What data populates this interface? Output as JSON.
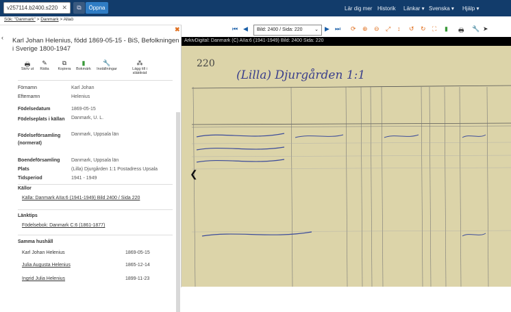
{
  "search": {
    "value": "v257114.b2400.s220"
  },
  "top": {
    "open_label": "Öppna",
    "nav": [
      "Lär dig mer",
      "Historik",
      "Länkar ▾",
      "Svenska ▾",
      "Hjälp ▾"
    ]
  },
  "breadcrumb": {
    "items": [
      "Sök: \"Danmark\"",
      "Danmark",
      "Allaö"
    ]
  },
  "panel": {
    "title": "Karl Johan Helenius, född 1869-05-15 - BiS, Befolkningen i Sverige 1800-1947",
    "tools": [
      "Skriv ut",
      "Rätta",
      "Kopiera",
      "Bokmärk",
      "Inställningar",
      "Lägg till i släktträd"
    ],
    "fields": [
      {
        "label": "Förnamn",
        "value": "Karl Johan"
      },
      {
        "label": "Efternamn",
        "value": "Helenius"
      },
      {
        "label": "Födelsedatum",
        "value": "1869-05-15"
      },
      {
        "label": "Födelseplats i källan",
        "value": "Danmark, U. L."
      },
      {
        "label": "Födelseförsamling (normerat)",
        "value": "Danmark, Uppsala län"
      },
      {
        "label": "Boendeförsamling",
        "value": "Danmark, Uppsala län"
      },
      {
        "label": "Plats",
        "value": "(Lilla) Djurgården 1:1 Postadress Upsala"
      },
      {
        "label": "Tidsperiod",
        "value": "1941 - 1949"
      }
    ],
    "sources_title": "Källor",
    "source_link": "Källa: Danmark AIIa:6 (1941-1949) Bild 2400 / Sida 220",
    "links_title": "Länktips",
    "links_link": "Födelsebok: Danmark C:6 (1861-1877)",
    "household_title": "Samma hushåll",
    "household": [
      {
        "name": "Karl Johan Helenius",
        "date": "1869-05-15"
      },
      {
        "name": "Julia Augusta Helenius",
        "date": "1865-12-14"
      },
      {
        "name": "Ingrid Julia Helenius",
        "date": "1899-11-23"
      }
    ]
  },
  "viewer": {
    "select": "Bild: 2400 / Sida: 220",
    "header": "ArkivDigital: Danmark (C) AIIa:6 (1941-1949) Bild: 2400 Sida: 220",
    "page_number": "220",
    "heading": "(Lilla) Djurgården 1:1"
  }
}
